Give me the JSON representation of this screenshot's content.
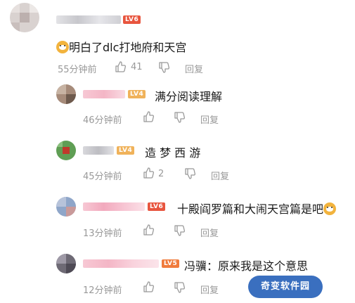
{
  "comments": [
    {
      "level": "LV6",
      "level_color": "#e8553e",
      "text": "明白了dlc打地府和天宫",
      "time": "55分钟前",
      "likes": "41",
      "reply": "回复"
    },
    {
      "level": "LV4",
      "level_color": "#f0b25a",
      "text": "满分阅读理解",
      "time": "46分钟前",
      "likes": "",
      "reply": "回复"
    },
    {
      "level": "LV4",
      "level_color": "#f0b25a",
      "text": "造 梦 西 游",
      "time": "45分钟前",
      "likes": "2",
      "reply": "回复"
    },
    {
      "level": "LV6",
      "level_color": "#e8553e",
      "text": "十殿阎罗篇和大闹天宫篇是吧",
      "time": "13分钟前",
      "likes": "",
      "reply": "回复"
    },
    {
      "level": "LV5",
      "level_color": "#f07b3c",
      "text": "冯骥：原来我是这个意思",
      "time": "12分钟前",
      "likes": "",
      "reply": "回复"
    }
  ],
  "icons": {
    "like": "thumbs-up-icon",
    "dislike": "thumbs-down-icon",
    "emoji": "doge-emoji-icon"
  },
  "watermark": "奇变软件园"
}
